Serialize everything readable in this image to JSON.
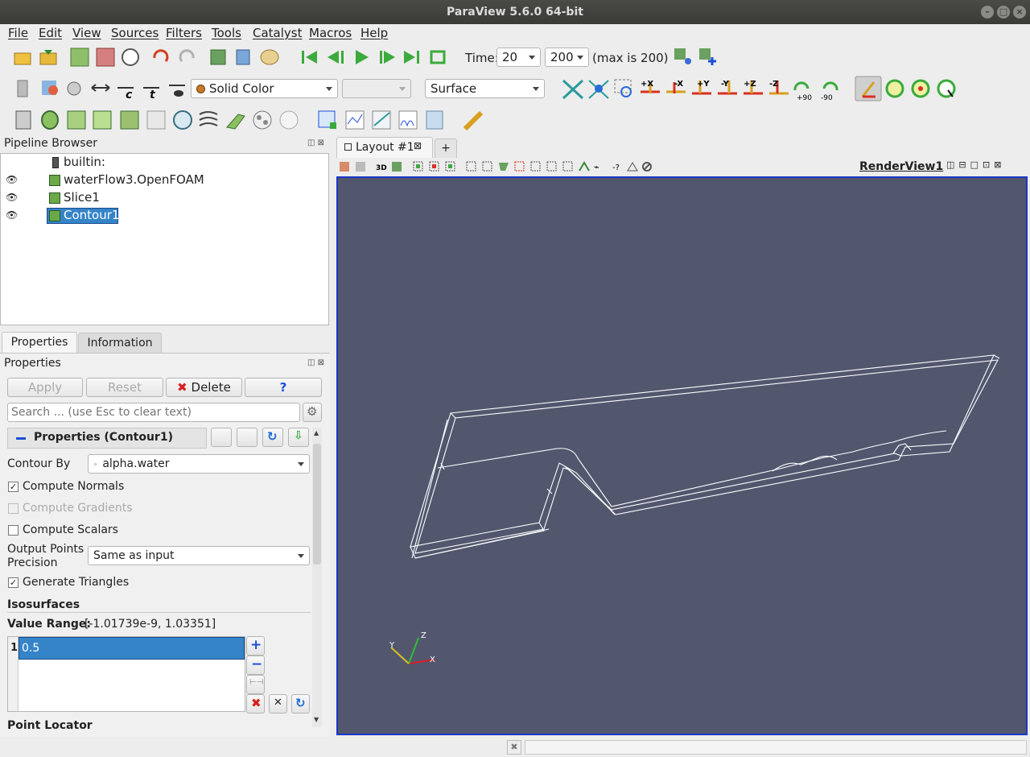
{
  "window": {
    "title": "ParaView 5.6.0 64-bit"
  },
  "menu": [
    "File",
    "Edit",
    "View",
    "Sources",
    "Filters",
    "Tools",
    "Catalyst",
    "Macros",
    "Help"
  ],
  "time": {
    "label": "Time:",
    "value": "20",
    "step": "200",
    "max_text": "(max is 200)"
  },
  "display": {
    "coloring": "Solid Color",
    "component": "",
    "representation": "Surface"
  },
  "camera": {
    "rotate_pos": "+90",
    "rotate_neg": "-90"
  },
  "pipeline": {
    "title": "Pipeline Browser",
    "items": [
      {
        "label": "builtin:",
        "visible": false
      },
      {
        "label": "waterFlow3.OpenFOAM",
        "visible": true
      },
      {
        "label": "Slice1",
        "visible": true
      },
      {
        "label": "Contour1",
        "visible": true,
        "selected": true
      }
    ]
  },
  "tabs": {
    "properties": "Properties",
    "information": "Information"
  },
  "properties": {
    "title": "Properties",
    "apply": "Apply",
    "reset": "Reset",
    "delete": "Delete",
    "help": "?",
    "search_placeholder": "Search ... (use Esc to clear text)",
    "section_title": "Properties (Contour1)",
    "contour_by_label": "Contour By",
    "contour_by_value": "alpha.water",
    "compute_normals": "Compute Normals",
    "compute_gradients": "Compute Gradients",
    "compute_scalars": "Compute Scalars",
    "precision_label_1": "Output Points",
    "precision_label_2": "Precision",
    "precision_value": "Same as input",
    "generate_triangles": "Generate Triangles",
    "isosurfaces": "Isosurfaces",
    "value_range_label": "Value Range:",
    "value_range": "[-1.01739e-9, 1.03351]",
    "iso_index": "1",
    "iso_value": "0.5",
    "point_locator": "Point Locator"
  },
  "layout": {
    "tab": "Layout #1",
    "add": "+",
    "view_name": "RenderView1",
    "mode3d": "3D"
  },
  "axes": {
    "x": "X",
    "y": "Y",
    "z": "Z"
  },
  "colors": {
    "viewport_bg": "#52576e",
    "selection": "#3584c8",
    "accent_border": "#1b36c8"
  }
}
